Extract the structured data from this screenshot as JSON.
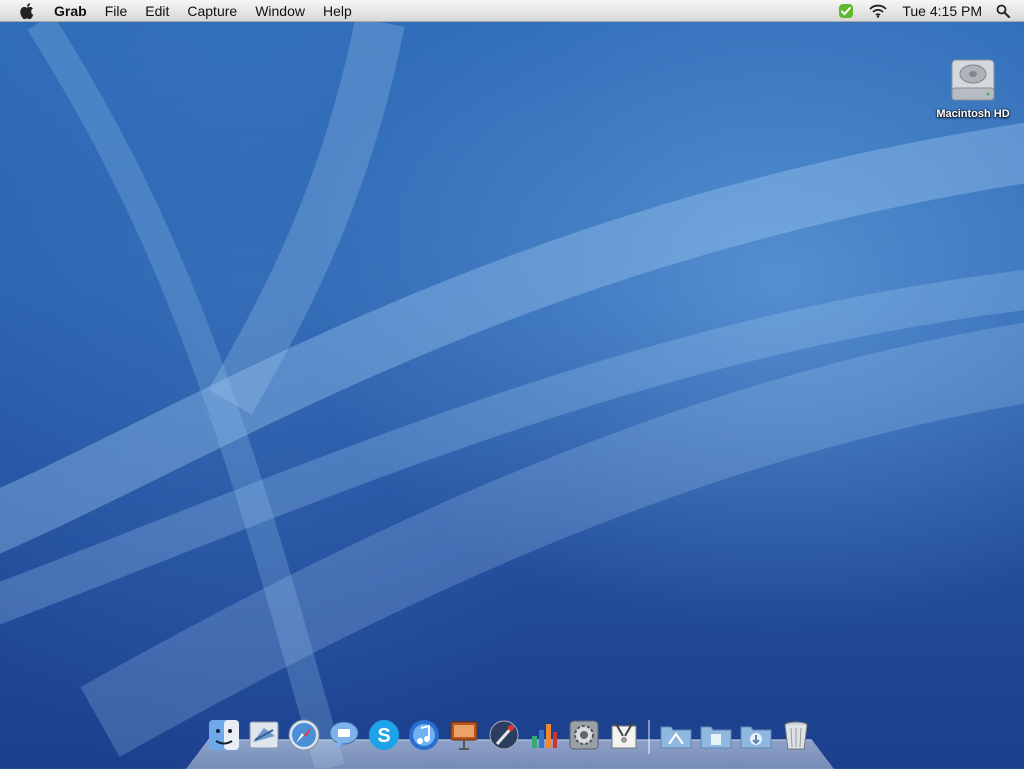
{
  "menubar": {
    "app_name": "Grab",
    "menus": [
      "File",
      "Edit",
      "Capture",
      "Window",
      "Help"
    ],
    "clock": "Tue 4:15 PM",
    "status_icons": [
      "checkmark-status-icon",
      "wifi-icon"
    ]
  },
  "desktop": {
    "icons": [
      {
        "label": "Macintosh HD",
        "icon": "hard-drive-icon"
      }
    ]
  },
  "dock": {
    "apps": [
      "finder-icon",
      "mail-icon",
      "safari-icon",
      "ichat-icon",
      "skype-icon",
      "itunes-icon",
      "keynote-icon",
      "instruments-icon",
      "dashboard-icon",
      "system-preferences-icon",
      "grab-icon"
    ],
    "folders": [
      "applications-folder-icon",
      "documents-folder-icon",
      "downloads-folder-icon"
    ],
    "trash": "trash-icon"
  },
  "colors": {
    "menubar_bg": "#e8e8e8",
    "desktop_bg": "#2b63b0",
    "label_text": "#ffffff"
  }
}
